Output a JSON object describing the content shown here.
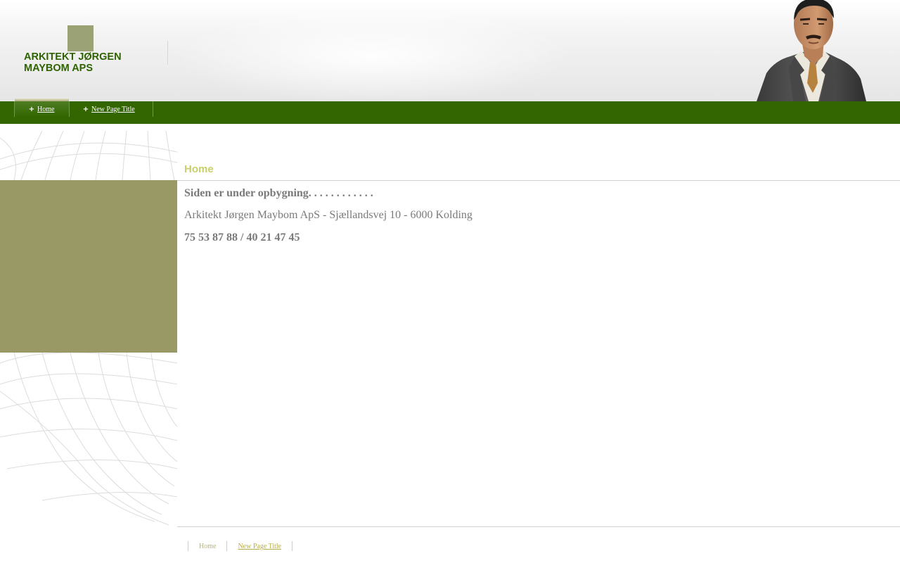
{
  "header": {
    "site_title": "ARKITEKT JØRGEN MAYBOM APS",
    "logo_icon": "square-logo-icon",
    "portrait": "businessman-portrait"
  },
  "nav": {
    "items": [
      {
        "label": "Home",
        "icon": "plus-icon",
        "active": true
      },
      {
        "label": "New Page Title",
        "icon": "plus-icon",
        "active": false
      }
    ]
  },
  "main": {
    "heading": "Home",
    "status_line": "Siden er under opbygning. . . . . . . . . . . .",
    "address_line": "Arkitekt Jørgen Maybom ApS - Sjællandsvej 10 - 6000 Kolding",
    "phone_line": "75 53 87 88 / 40 21 47 45"
  },
  "footer": {
    "items": [
      {
        "label": "Home"
      },
      {
        "label": "New Page Title"
      }
    ]
  },
  "colors": {
    "nav_green": "#336600",
    "olive": "#999966",
    "title_green": "#2f6200",
    "heading_yellow": "#c9cf6a",
    "text_gray": "#7a7a7a"
  }
}
